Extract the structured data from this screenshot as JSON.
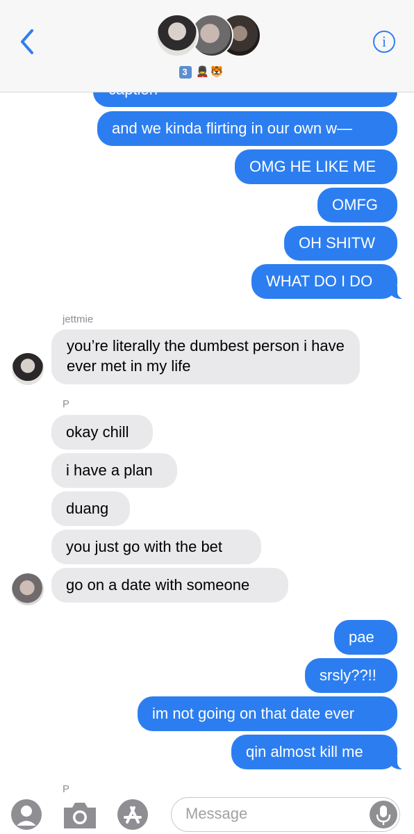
{
  "header": {
    "group_emoji": "💂🐯",
    "group_number": "3"
  },
  "messages": {
    "out1": "caption",
    "out2": "and we kinda flirting in our own w—",
    "out3": "OMG HE LIKE ME",
    "out4": "OMFG",
    "out5": "OH SHITW",
    "out6": "WHAT DO I DO",
    "sender1": "jettmie",
    "in1": "you’re literally the dumbest person i have ever met in my life",
    "sender2": "P",
    "in2": "okay chill",
    "in3": "i have a plan",
    "in4": "duang",
    "in5": "you just go with the bet",
    "in6": "go on a date with someone",
    "out7": "pae",
    "out8": "srsly??!!",
    "out9": "im not going on that date ever",
    "out10": "qin almost kill me",
    "sender3": "P"
  },
  "composer": {
    "placeholder": "Message"
  },
  "colors": {
    "accent": "#2c7ef0",
    "incoming_bubble": "#e9e9eb"
  }
}
